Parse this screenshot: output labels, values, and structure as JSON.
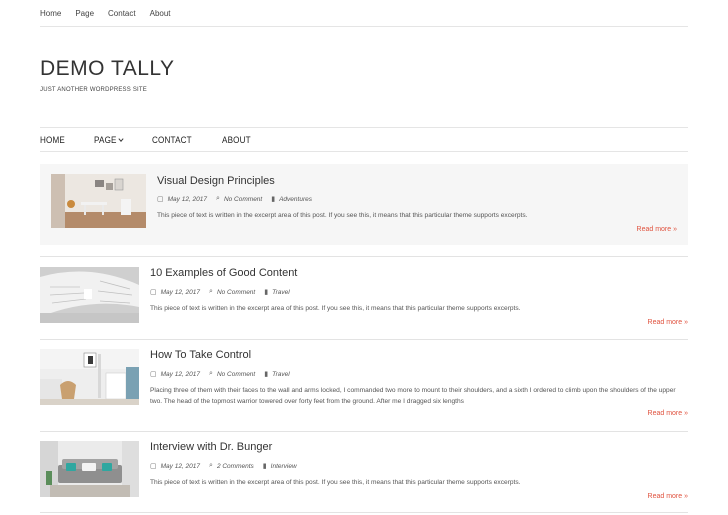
{
  "top_nav": [
    "Home",
    "Page",
    "Contact",
    "About"
  ],
  "site": {
    "title": "DEMO TALLY",
    "description": "JUST ANOTHER WORDPRESS SITE"
  },
  "main_nav": [
    "HOME",
    "PAGE",
    "CONTACT",
    "ABOUT"
  ],
  "read_more": "Read more »",
  "posts": [
    {
      "title": "Visual Design Principles",
      "date": "May 12, 2017",
      "comments": "No Comment",
      "category": "Adventures",
      "excerpt": "This piece of text is written in the excerpt area of this post. If you see this, it means that this particular theme supports excerpts."
    },
    {
      "title": "10 Examples of Good Content",
      "date": "May 12, 2017",
      "comments": "No Comment",
      "category": "Travel",
      "excerpt": "This piece of text is written in the excerpt area of this post. If you see this, it means that this particular theme supports excerpts."
    },
    {
      "title": "How To Take Control",
      "date": "May 12, 2017",
      "comments": "No Comment",
      "category": "Travel",
      "excerpt": "Placing three of them with their faces to the wall and arms locked, I commanded two more to mount to their shoulders, and a sixth I ordered to climb upon the shoulders of the upper two. The head of the topmost warrior towered over forty feet from the ground. After me I dragged six lengths"
    },
    {
      "title": "Interview with Dr. Bunger",
      "date": "May 12, 2017",
      "comments": "2 Comments",
      "category": "Interview",
      "excerpt": "This piece of text is written in the excerpt area of this post. If you see this, it means that this particular theme supports excerpts."
    }
  ],
  "colors": {
    "accent": "#e0533f",
    "featured_bg": "#f6f6f6"
  }
}
